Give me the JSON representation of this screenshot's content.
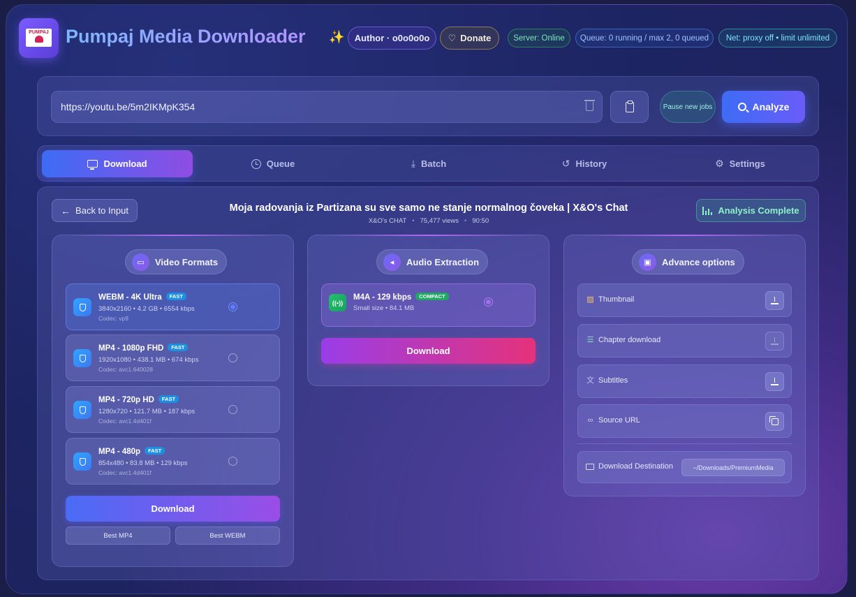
{
  "header": {
    "logo_text": "PUMPAJ",
    "title": "Pumpaj Media Downloader",
    "author": "Author · o0o0o0o",
    "donate": "Donate",
    "server_status": "Server: Online",
    "queue_status": "Queue: 0 running / max 2, 0 queued",
    "net_status": "Net: proxy off • limit unlimited"
  },
  "url_bar": {
    "value": "https://youtu.be/5m2IKMpK354",
    "pause_label": "Pause new jobs",
    "analyze_label": "Analyze"
  },
  "tabs": [
    {
      "label": "Download",
      "active": true,
      "icon": "monitor-icon"
    },
    {
      "label": "Queue",
      "active": false,
      "icon": "clock-icon"
    },
    {
      "label": "Batch",
      "active": false,
      "icon": "download-icon"
    },
    {
      "label": "History",
      "active": false,
      "icon": "history-icon"
    },
    {
      "label": "Settings",
      "active": false,
      "icon": "gear-icon"
    }
  ],
  "result": {
    "back_label": "Back to Input",
    "title": "Moja radovanja iz Partizana su sve samo ne stanje normalnog čoveka | X&O's Chat",
    "channel": "X&O's CHAT",
    "views": "75,477 views",
    "duration": "90:50",
    "status": "Analysis Complete"
  },
  "video": {
    "heading": "Video Formats",
    "formats": [
      {
        "name": "WEBM - 4K Ultra",
        "badge": "FAST",
        "detail": "3840x2160 • 4.2 GB • 6554 kbps",
        "codec": "Codec: vp9",
        "selected": true
      },
      {
        "name": "MP4 - 1080p FHD",
        "badge": "FAST",
        "detail": "1920x1080 • 438.1 MB • 674 kbps",
        "codec": "Codec: avc1.640028",
        "selected": false
      },
      {
        "name": "MP4 - 720p HD",
        "badge": "FAST",
        "detail": "1280x720 • 121.7 MB • 187 kbps",
        "codec": "Codec: avc1.4d401f",
        "selected": false
      },
      {
        "name": "MP4 - 480p",
        "badge": "FAST",
        "detail": "854x480 • 83.8 MB • 129 kbps",
        "codec": "Codec: avc1.4d401f",
        "selected": false
      }
    ],
    "download_label": "Download",
    "best_mp4": "Best MP4",
    "best_webm": "Best WEBM"
  },
  "audio": {
    "heading": "Audio Extraction",
    "format": {
      "name": "M4A - 129 kbps",
      "badge": "COMPACT",
      "detail": "Small size • 84.1 MB",
      "selected": true
    },
    "download_label": "Download"
  },
  "advanced": {
    "heading": "Advance options",
    "options": [
      {
        "label": "Thumbnail",
        "action": "download",
        "enabled": true
      },
      {
        "label": "Chapter download",
        "action": "download",
        "enabled": false
      },
      {
        "label": "Subtitles",
        "action": "download",
        "enabled": true
      },
      {
        "label": "Source URL",
        "action": "copy",
        "enabled": true
      }
    ],
    "destination_label": "Download Destination",
    "destination_path": "~/Downloads/PremiumMedia"
  },
  "colors": {
    "accent_blue": "#3d6cf5",
    "accent_purple": "#8f4de3",
    "audio_gradient_end": "#e5327a",
    "success": "#8ef0c8"
  }
}
